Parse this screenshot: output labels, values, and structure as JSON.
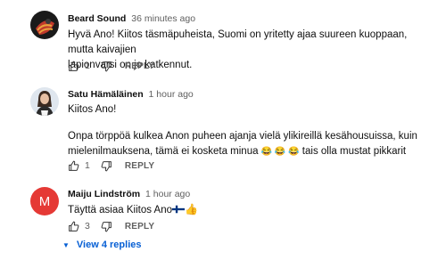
{
  "comments": [
    {
      "author": "Beard Sound",
      "time": "36 minutes ago",
      "text_lines": [
        "Hyvä Ano!  Kiitos täsmäpuheista,  Suomi on yritetty ajaa suureen kuoppaan, mutta kaivajien",
        "lapionvarsi on jo katkennut."
      ],
      "likes": "1",
      "reply_label": "REPLY"
    },
    {
      "author": "Satu Hämäläinen",
      "time": "1 hour ago",
      "text_line1": "Kiitos Ano!",
      "text_line2": "Onpa törppöä kulkea Anon puheen ajanja vielä ylikireillä kesähousuissa, kuin",
      "text_line3_before": "mielenilmauksena, tämä ei kosketa minua ",
      "emojis": "😂 😂 😂",
      "text_line3_after": " tais olla mustat pikkarit",
      "likes": "1",
      "reply_label": "REPLY"
    },
    {
      "author": "Maiju Lindström",
      "time": "1 hour ago",
      "text": "Täyttä asiaa Kiitos Ano",
      "thumb_emoji": "👍",
      "avatar_letter": "M",
      "likes": "3",
      "reply_label": "REPLY"
    }
  ],
  "view_replies": "View 4 replies",
  "colors": {
    "avatar_m": "#e53935",
    "link": "#065fd4",
    "secondary_text": "#606060"
  }
}
